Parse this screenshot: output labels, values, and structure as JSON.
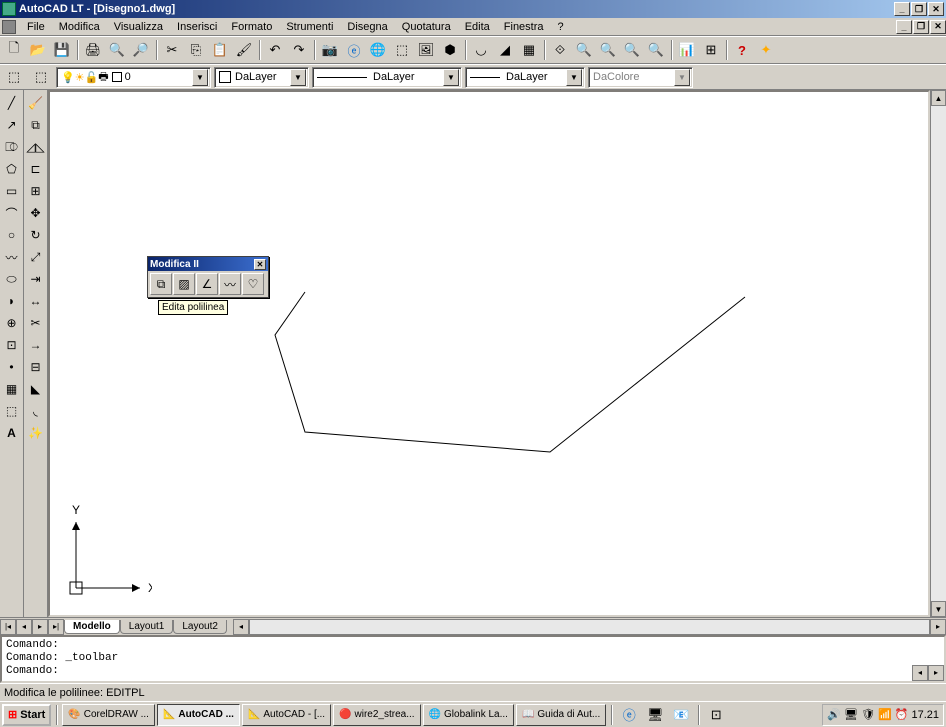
{
  "title": "AutoCAD LT - [Disegno1.dwg]",
  "menu": [
    "File",
    "Modifica",
    "Visualizza",
    "Inserisci",
    "Formato",
    "Strumenti",
    "Disegna",
    "Quotatura",
    "Edita",
    "Finestra",
    "?"
  ],
  "layer_combo": "0",
  "color_combo": "DaLayer",
  "linetype_combo": "DaLayer",
  "lineweight_combo": "DaLayer",
  "plotstyle_combo": "DaColore",
  "float_title": "Modifica II",
  "float_tooltip": "Edita polilinea",
  "tabs": {
    "active": "Modello",
    "others": [
      "Layout1",
      "Layout2"
    ]
  },
  "command_lines": [
    "Comando:",
    "Comando: _toolbar",
    "Comando:"
  ],
  "status_text": "Modifica le polilinee: EDITPL",
  "taskbar": {
    "start": "Start",
    "items": [
      {
        "label": "CorelDRAW ...",
        "active": false
      },
      {
        "label": "AutoCAD ...",
        "active": true
      },
      {
        "label": "AutoCAD - [...",
        "active": false
      },
      {
        "label": "wire2_strea...",
        "active": false
      },
      {
        "label": "Globalink La...",
        "active": false
      },
      {
        "label": "Guida di Aut...",
        "active": false
      }
    ],
    "clock": "17.21"
  },
  "ucs": {
    "x": "X",
    "y": "Y"
  }
}
